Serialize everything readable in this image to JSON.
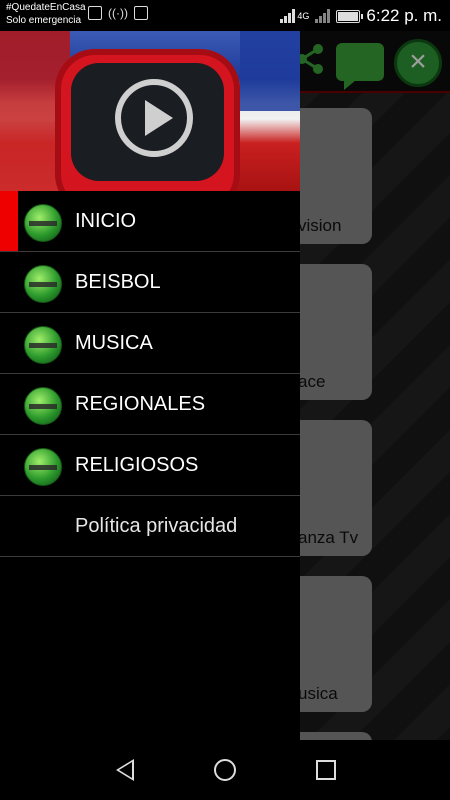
{
  "status_bar": {
    "line1": "#QuedateEnCasa",
    "line2": "Solo emergencia",
    "network": "4G",
    "time": "6:22 p. m."
  },
  "background_cards": [
    {
      "label": "vision"
    },
    {
      "label": "ace"
    },
    {
      "label": "anza Tv"
    },
    {
      "label": "usica"
    }
  ],
  "toolbar": {
    "close_glyph": "×"
  },
  "drawer": {
    "items": [
      {
        "label": "INICIO",
        "active": true,
        "icon": "globe-logo-icon"
      },
      {
        "label": "BEISBOL",
        "active": false,
        "icon": "globe-logo-icon"
      },
      {
        "label": "MUSICA",
        "active": false,
        "icon": "globe-logo-icon"
      },
      {
        "label": "REGIONALES",
        "active": false,
        "icon": "globe-logo-icon"
      },
      {
        "label": "RELIGIOSOS",
        "active": false,
        "icon": "globe-logo-icon"
      },
      {
        "label": "Política privacidad",
        "active": false,
        "icon": ""
      }
    ]
  },
  "colors": {
    "accent_red": "#ee0000",
    "close_green": "#2f9a38",
    "chat_green": "#3aa33a"
  }
}
